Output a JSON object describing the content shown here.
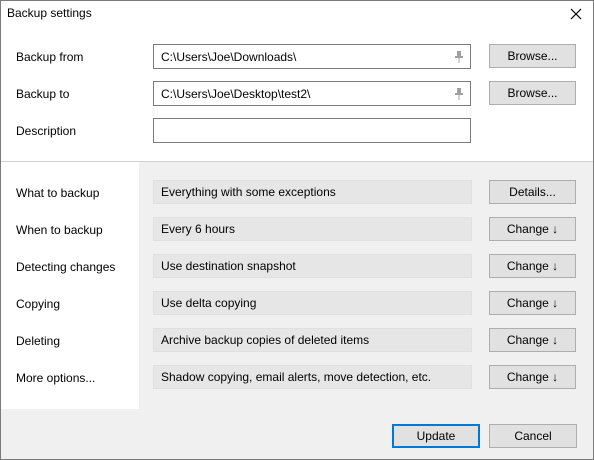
{
  "window": {
    "title": "Backup settings"
  },
  "source": {
    "label": "Backup from",
    "value": "C:\\Users\\Joe\\Downloads\\",
    "button_label": "Browse..."
  },
  "destination": {
    "label": "Backup to",
    "value": "C:\\Users\\Joe\\Desktop\\test2\\",
    "button_label": "Browse..."
  },
  "description": {
    "label": "Description",
    "value": ""
  },
  "settings": [
    {
      "label": "What to backup",
      "value": "Everything with some exceptions",
      "button_label": "Details..."
    },
    {
      "label": "When to backup",
      "value": "Every 6 hours",
      "button_label": "Change ↓"
    },
    {
      "label": "Detecting changes",
      "value": "Use destination snapshot",
      "button_label": "Change ↓"
    },
    {
      "label": "Copying",
      "value": "Use delta copying",
      "button_label": "Change ↓"
    },
    {
      "label": "Deleting",
      "value": "Archive backup copies of deleted items",
      "button_label": "Change ↓"
    },
    {
      "label": "More options...",
      "value": "Shadow copying, email alerts, move detection, etc.",
      "button_label": "Change ↓"
    }
  ],
  "footer": {
    "update_label": "Update",
    "cancel_label": "Cancel"
  },
  "colors": {
    "window_bg": "#f0f0f0",
    "panel_bg": "#ffffff",
    "readonly_field_bg": "#e6e6e6",
    "button_bg": "#e1e1e1",
    "default_button_border": "#0078d7"
  },
  "icons": {
    "close": "close-icon",
    "pin": "pin-icon"
  }
}
